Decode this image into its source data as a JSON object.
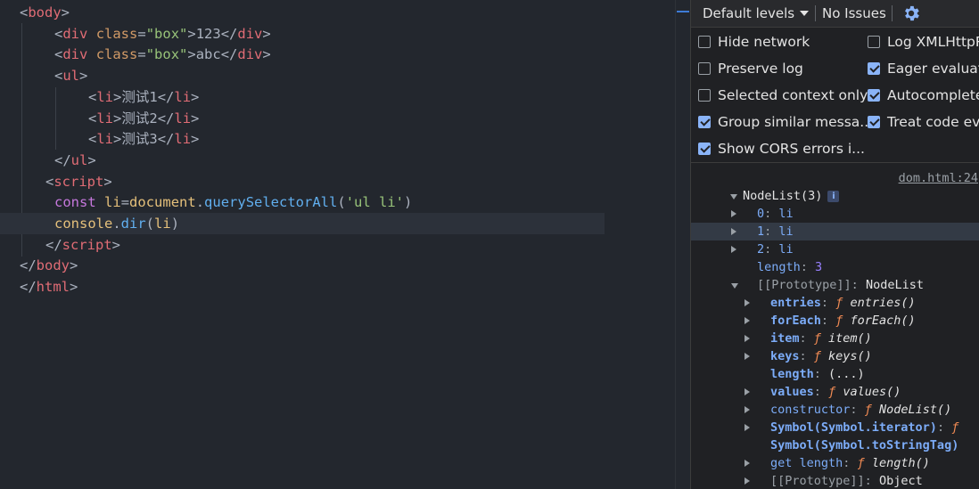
{
  "editor": {
    "lines": [
      [
        [
          "tok-punct",
          "<"
        ],
        [
          "tok-tag",
          "body"
        ],
        [
          "tok-punct",
          ">"
        ]
      ],
      [
        [
          "tok-punct",
          "<"
        ],
        [
          "tok-tag",
          "div"
        ],
        [
          "tok-txt",
          " "
        ],
        [
          "tok-attr",
          "class"
        ],
        [
          "tok-punct",
          "="
        ],
        [
          "tok-str",
          "\"box\""
        ],
        [
          "tok-punct",
          ">"
        ],
        [
          "tok-txt",
          "123"
        ],
        [
          "tok-punct",
          "</"
        ],
        [
          "tok-tag",
          "div"
        ],
        [
          "tok-punct",
          ">"
        ]
      ],
      [
        [
          "tok-punct",
          "<"
        ],
        [
          "tok-tag",
          "div"
        ],
        [
          "tok-txt",
          " "
        ],
        [
          "tok-attr",
          "class"
        ],
        [
          "tok-punct",
          "="
        ],
        [
          "tok-str",
          "\"box\""
        ],
        [
          "tok-punct",
          ">"
        ],
        [
          "tok-txt",
          "abc"
        ],
        [
          "tok-punct",
          "</"
        ],
        [
          "tok-tag",
          "div"
        ],
        [
          "tok-punct",
          ">"
        ]
      ],
      [
        [
          "tok-punct",
          "<"
        ],
        [
          "tok-tag",
          "ul"
        ],
        [
          "tok-punct",
          ">"
        ]
      ],
      [
        [
          "tok-punct",
          "<"
        ],
        [
          "tok-tag",
          "li"
        ],
        [
          "tok-punct",
          ">"
        ],
        [
          "tok-txt",
          "测试1"
        ],
        [
          "tok-punct",
          "</"
        ],
        [
          "tok-tag",
          "li"
        ],
        [
          "tok-punct",
          ">"
        ]
      ],
      [
        [
          "tok-punct",
          "<"
        ],
        [
          "tok-tag",
          "li"
        ],
        [
          "tok-punct",
          ">"
        ],
        [
          "tok-txt",
          "测试2"
        ],
        [
          "tok-punct",
          "</"
        ],
        [
          "tok-tag",
          "li"
        ],
        [
          "tok-punct",
          ">"
        ]
      ],
      [
        [
          "tok-punct",
          "<"
        ],
        [
          "tok-tag",
          "li"
        ],
        [
          "tok-punct",
          ">"
        ],
        [
          "tok-txt",
          "测试3"
        ],
        [
          "tok-punct",
          "</"
        ],
        [
          "tok-tag",
          "li"
        ],
        [
          "tok-punct",
          ">"
        ]
      ],
      [
        [
          "tok-punct",
          "</"
        ],
        [
          "tok-tag",
          "ul"
        ],
        [
          "tok-punct",
          ">"
        ]
      ],
      [
        [
          "tok-punct",
          "<"
        ],
        [
          "tok-tag",
          "script"
        ],
        [
          "tok-punct",
          ">"
        ]
      ],
      [
        [
          "tok-kw",
          "const"
        ],
        [
          "tok-txt",
          " "
        ],
        [
          "tok-var",
          "li"
        ],
        [
          "tok-punct",
          "="
        ],
        [
          "tok-var",
          "document"
        ],
        [
          "tok-punct",
          "."
        ],
        [
          "tok-fn",
          "querySelectorAll"
        ],
        [
          "tok-punct",
          "("
        ],
        [
          "tok-str",
          "'ul li'"
        ],
        [
          "tok-punct",
          ")"
        ]
      ],
      [
        [
          "tok-var",
          "console"
        ],
        [
          "tok-punct",
          "."
        ],
        [
          "tok-fn",
          "dir"
        ],
        [
          "tok-punct",
          "("
        ],
        [
          "tok-var",
          "li"
        ],
        [
          "tok-punct",
          ")"
        ]
      ],
      [
        [
          "tok-punct",
          "</"
        ],
        [
          "tok-tag",
          "script"
        ],
        [
          "tok-punct",
          ">"
        ]
      ],
      [
        [
          "tok-punct",
          "</"
        ],
        [
          "tok-tag",
          "body"
        ],
        [
          "tok-punct",
          ">"
        ]
      ],
      [
        [
          "tok-punct",
          "</"
        ],
        [
          "tok-tag",
          "html"
        ],
        [
          "tok-punct",
          ">"
        ]
      ]
    ],
    "active_line": 10
  },
  "toolbar": {
    "levels_label": "Default levels",
    "issues_label": "No Issues",
    "settings_icon": "gear-icon"
  },
  "settings": {
    "left": [
      {
        "label": "Hide network",
        "checked": false
      },
      {
        "label": "Preserve log",
        "checked": false
      },
      {
        "label": "Selected context only",
        "checked": false
      },
      {
        "label": "Group similar messa...",
        "checked": true
      },
      {
        "label": "Show CORS errors i...",
        "checked": true
      }
    ],
    "right": [
      {
        "label": "Log XMLHttpR",
        "checked": false
      },
      {
        "label": "Eager evaluatio",
        "checked": true
      },
      {
        "label": "Autocomplete",
        "checked": true
      },
      {
        "label": "Treat code eva",
        "checked": true
      }
    ]
  },
  "console": {
    "source_link": "dom.html:24",
    "header": "NodeList(3)",
    "info_badge": "i",
    "rows": [
      {
        "expander": "right",
        "parts": [
          [
            "k-idx",
            "0"
          ],
          [
            "k-dim",
            ": "
          ],
          [
            "k-idx",
            "li"
          ]
        ]
      },
      {
        "expander": "right",
        "parts": [
          [
            "k-idx",
            "1"
          ],
          [
            "k-dim",
            ": "
          ],
          [
            "k-idx",
            "li"
          ]
        ]
      },
      {
        "expander": "right",
        "parts": [
          [
            "k-idx",
            "2"
          ],
          [
            "k-dim",
            ": "
          ],
          [
            "k-idx",
            "li"
          ]
        ]
      },
      {
        "expander": "none",
        "parts": [
          [
            "k-idx",
            "length"
          ],
          [
            "k-dim",
            ": "
          ],
          [
            "k-num",
            "3"
          ]
        ]
      },
      {
        "expander": "down",
        "parts": [
          [
            "k-dim",
            "[[Prototype]]"
          ],
          [
            "k-dim",
            ": "
          ],
          [
            "",
            "NodeList"
          ]
        ]
      },
      {
        "expander": "right",
        "parts": [
          [
            "k-key",
            "entries"
          ],
          [
            "k-dim",
            ": "
          ],
          [
            "k-fsym",
            "ƒ "
          ],
          [
            "k-fname",
            "entries()"
          ]
        ]
      },
      {
        "expander": "right",
        "parts": [
          [
            "k-key",
            "forEach"
          ],
          [
            "k-dim",
            ": "
          ],
          [
            "k-fsym",
            "ƒ "
          ],
          [
            "k-fname",
            "forEach()"
          ]
        ]
      },
      {
        "expander": "right",
        "parts": [
          [
            "k-key",
            "item"
          ],
          [
            "k-dim",
            ": "
          ],
          [
            "k-fsym",
            "ƒ "
          ],
          [
            "k-fname",
            "item()"
          ]
        ]
      },
      {
        "expander": "right",
        "parts": [
          [
            "k-key",
            "keys"
          ],
          [
            "k-dim",
            ": "
          ],
          [
            "k-fsym",
            "ƒ "
          ],
          [
            "k-fname",
            "keys()"
          ]
        ]
      },
      {
        "expander": "none",
        "parts": [
          [
            "k-key",
            "length"
          ],
          [
            "k-dim",
            ": "
          ],
          [
            "",
            "(...)"
          ]
        ]
      },
      {
        "expander": "right",
        "parts": [
          [
            "k-key",
            "values"
          ],
          [
            "k-dim",
            ": "
          ],
          [
            "k-fsym",
            "ƒ "
          ],
          [
            "k-fname",
            "values()"
          ]
        ]
      },
      {
        "expander": "right",
        "parts": [
          [
            "k-get",
            "constructor"
          ],
          [
            "k-dim",
            ": "
          ],
          [
            "k-fsym",
            "ƒ "
          ],
          [
            "k-fname",
            "NodeList()"
          ]
        ]
      },
      {
        "expander": "right",
        "parts": [
          [
            "k-key",
            "Symbol(Symbol.iterator)"
          ],
          [
            "k-dim",
            ": "
          ],
          [
            "k-fsym",
            "ƒ"
          ]
        ]
      },
      {
        "expander": "none",
        "parts": [
          [
            "k-key",
            "Symbol(Symbol.toStringTag)"
          ]
        ]
      },
      {
        "expander": "right",
        "parts": [
          [
            "k-get",
            "get length"
          ],
          [
            "k-dim",
            ": "
          ],
          [
            "k-fsym",
            "ƒ "
          ],
          [
            "k-fname",
            "length()"
          ]
        ]
      },
      {
        "expander": "right",
        "parts": [
          [
            "k-dim",
            "[[Prototype]]"
          ],
          [
            "k-dim",
            ": "
          ],
          [
            "",
            "Object"
          ]
        ]
      }
    ],
    "highlight_row": 1
  }
}
